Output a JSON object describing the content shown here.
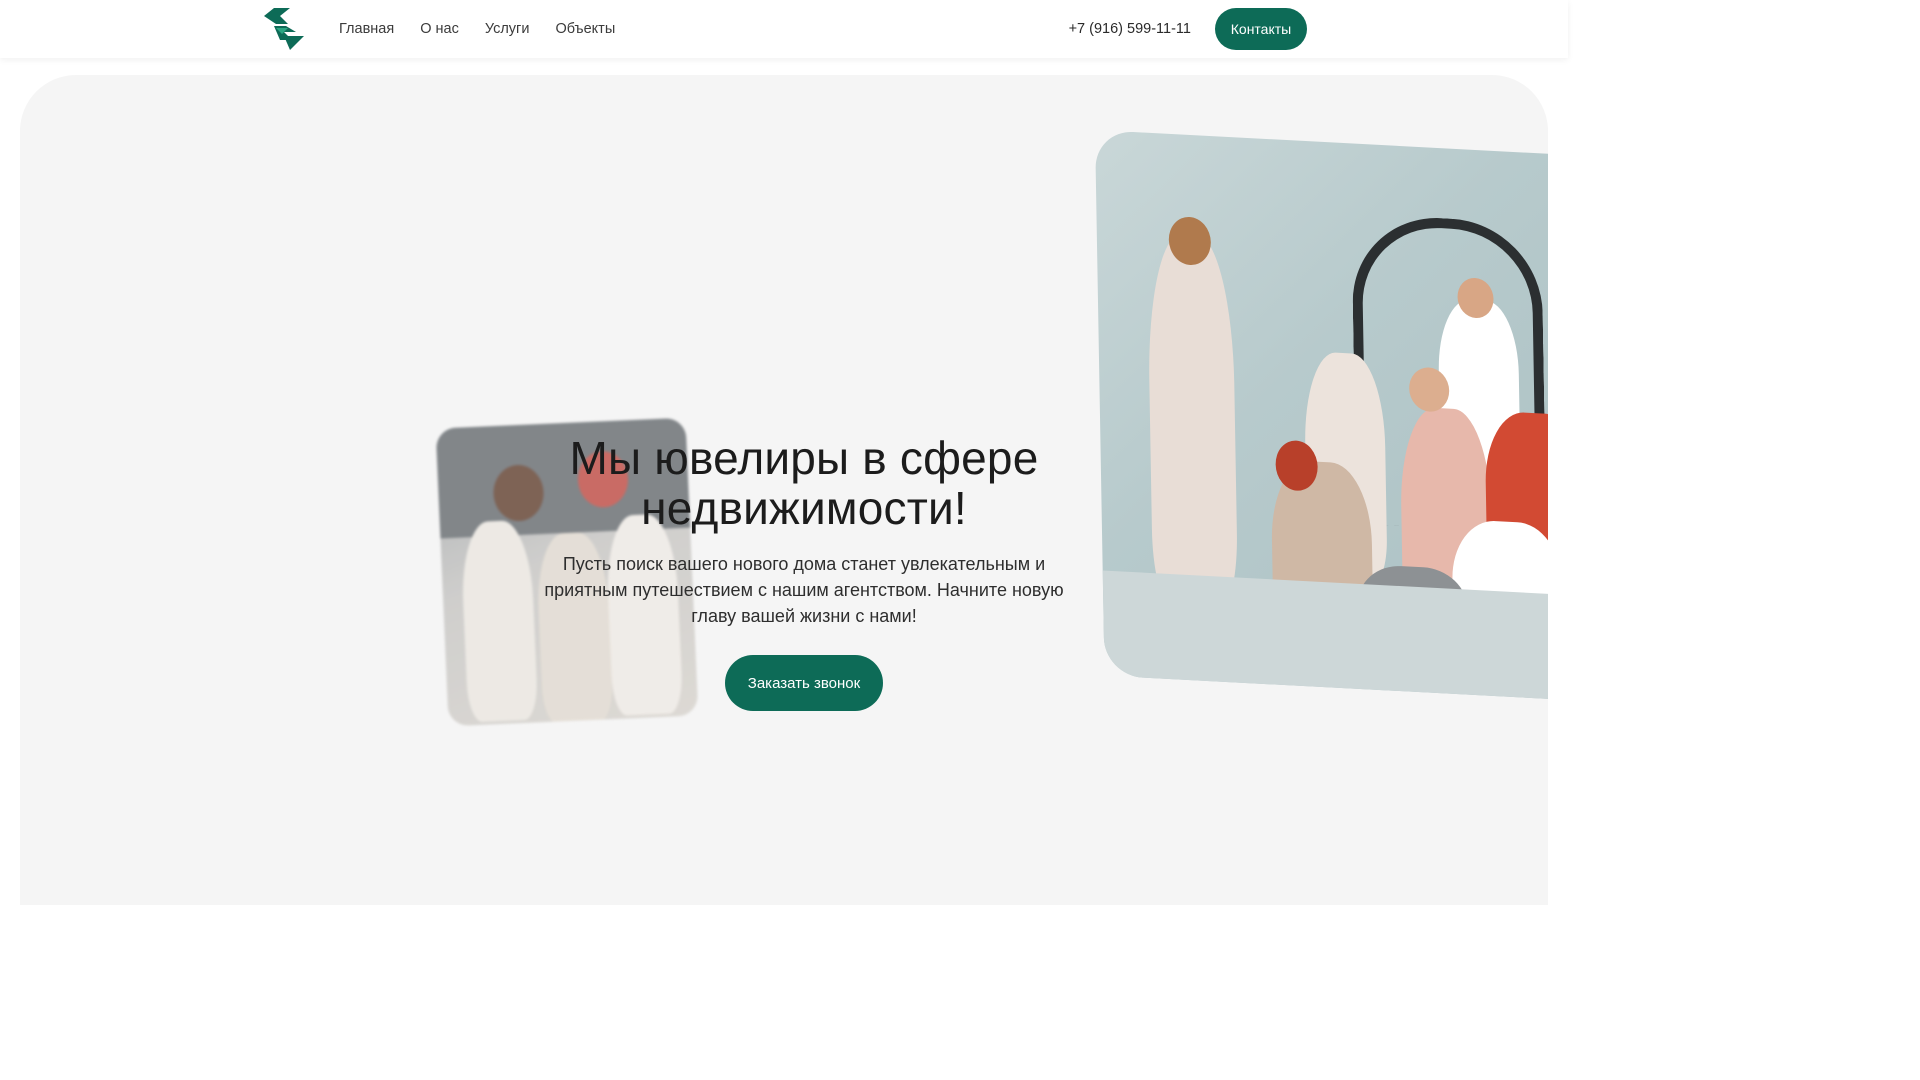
{
  "header": {
    "nav": [
      {
        "label": "Главная"
      },
      {
        "label": "О нас"
      },
      {
        "label": "Услуги"
      },
      {
        "label": "Объекты"
      }
    ],
    "phone": "+7 (916) 599-11-11",
    "contacts_label": "Контакты"
  },
  "hero": {
    "title": "Мы ювелиры в сфере недвижимости!",
    "subtitle": "Пусть поиск вашего нового дома станет увлекательным и приятным путешествием с нашим агентством. Начните новую главу вашей жизни с нами!",
    "cta_label": "Заказать звонок"
  },
  "colors": {
    "brand": "#0d6b57",
    "hero_bg": "#f5f5f5"
  },
  "icons": {
    "logo": "brand-logo-icon"
  }
}
